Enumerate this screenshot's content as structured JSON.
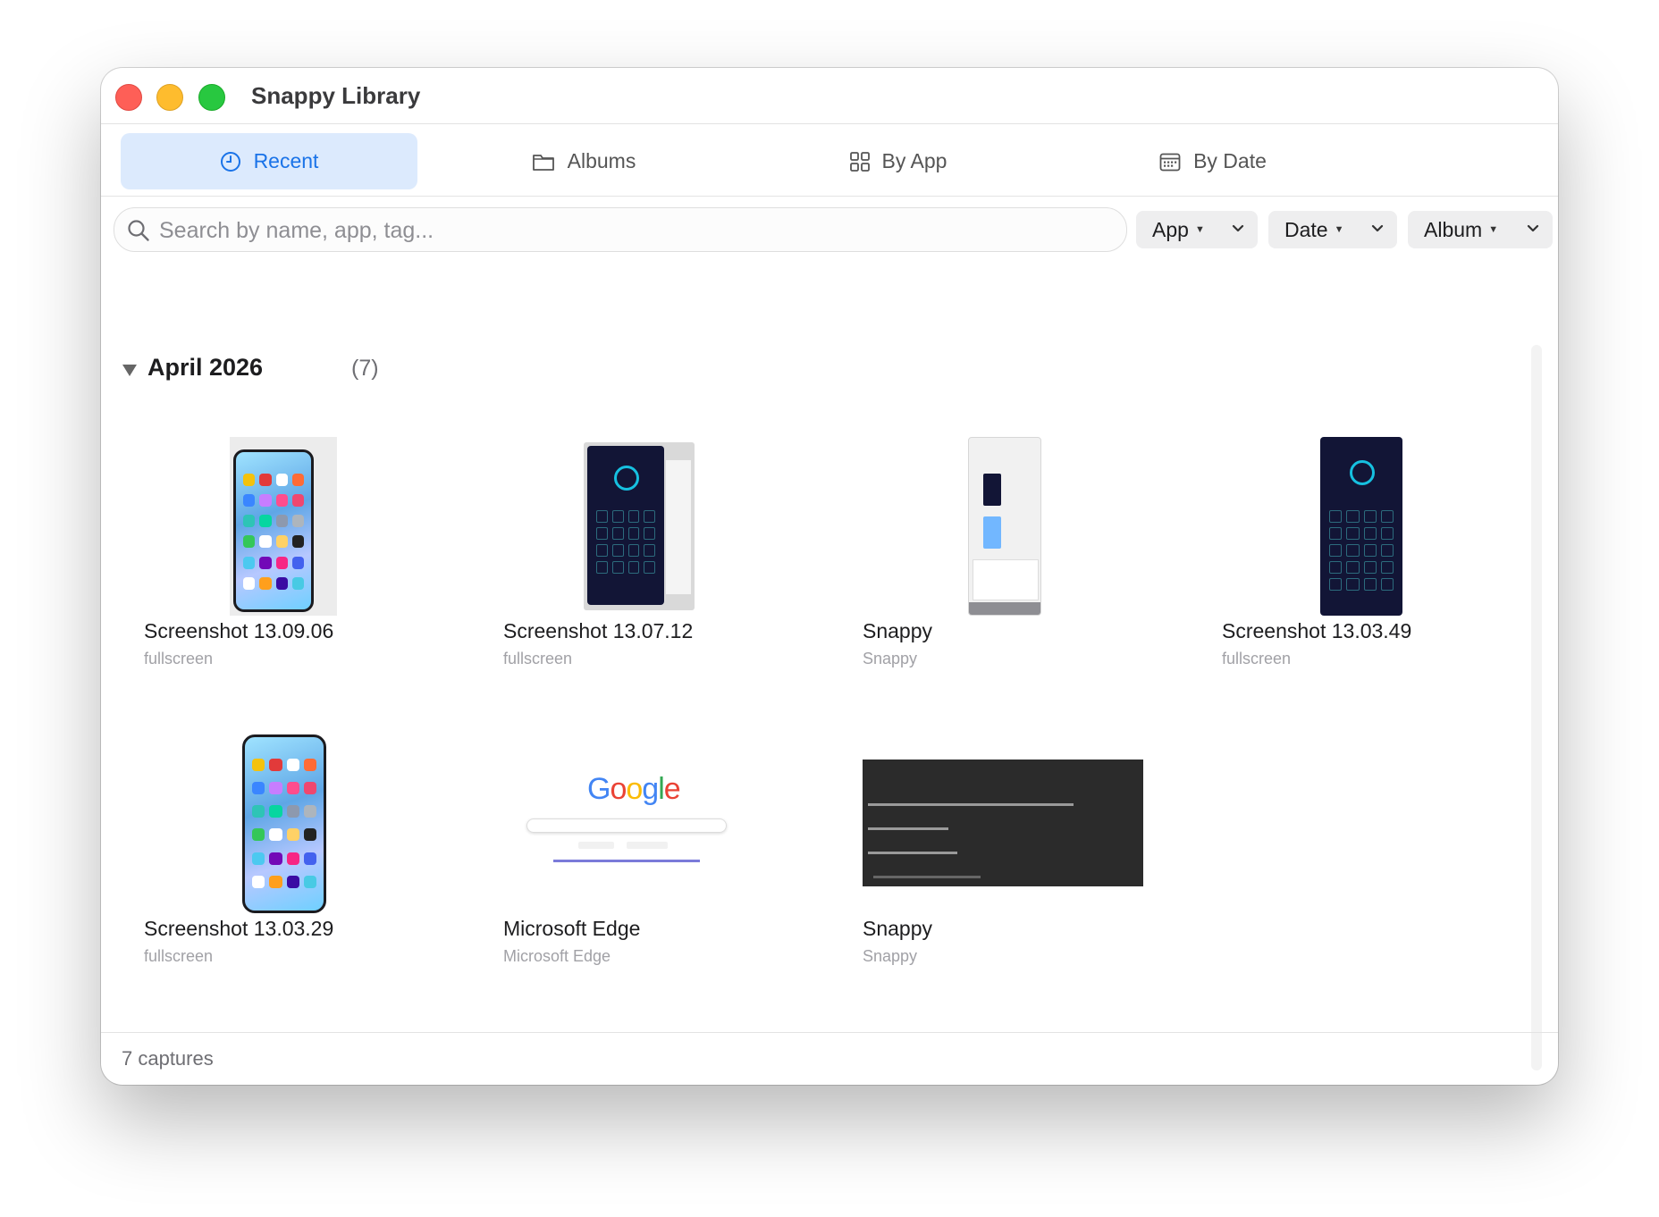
{
  "window": {
    "title": "Snappy Library"
  },
  "tabs": [
    {
      "label": "Recent",
      "icon": "clock-icon",
      "active": true
    },
    {
      "label": "Albums",
      "icon": "folder-icon",
      "active": false
    },
    {
      "label": "By App",
      "icon": "grid-icon",
      "active": false
    },
    {
      "label": "By Date",
      "icon": "calendar-icon",
      "active": false
    }
  ],
  "search": {
    "placeholder": "Search by name, app, tag..."
  },
  "filters": [
    {
      "label": "App"
    },
    {
      "label": "Date"
    },
    {
      "label": "Album"
    }
  ],
  "section": {
    "title": "April 2026",
    "count": "(7)"
  },
  "captures": [
    {
      "title": "Screenshot 13.09.06",
      "subtitle": "fullscreen"
    },
    {
      "title": "Screenshot 13.07.12",
      "subtitle": "fullscreen"
    },
    {
      "title": "Snappy",
      "subtitle": "Snappy"
    },
    {
      "title": "Screenshot 13.03.49",
      "subtitle": "fullscreen"
    },
    {
      "title": "Screenshot 13.03.29",
      "subtitle": "fullscreen"
    },
    {
      "title": "Microsoft Edge",
      "subtitle": "Microsoft Edge"
    },
    {
      "title": "Snappy",
      "subtitle": "Snappy"
    }
  ],
  "footer": {
    "status": "7 captures"
  },
  "colors": {
    "accent": "#1a73e8",
    "active_tab_bg": "#dceafd"
  }
}
